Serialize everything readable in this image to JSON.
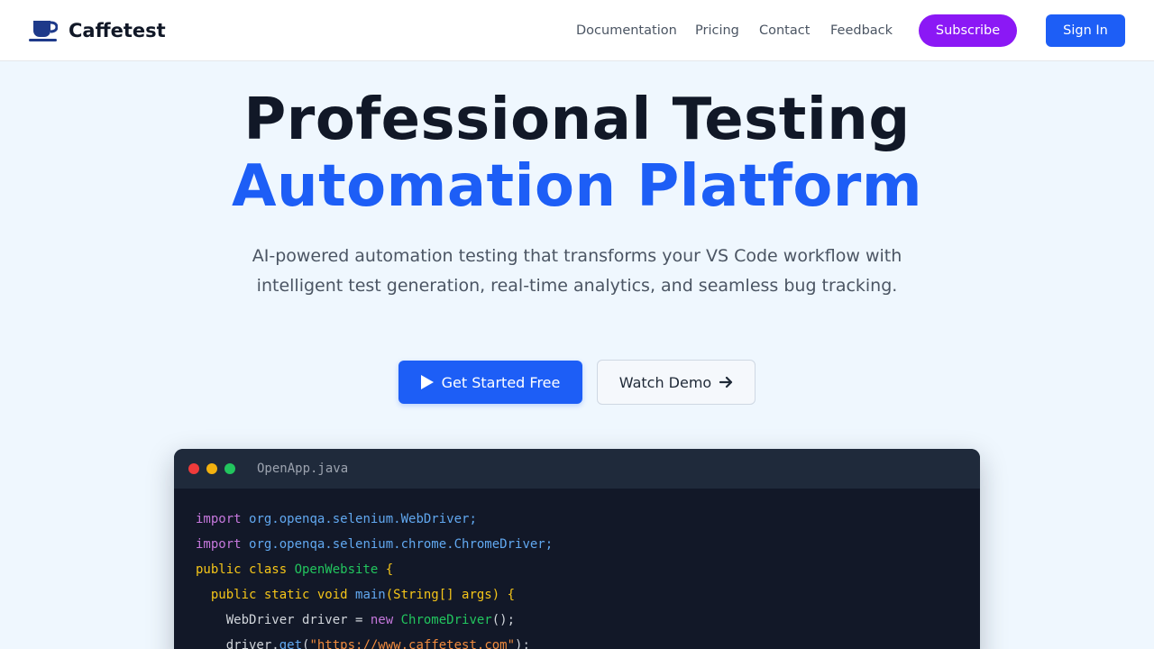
{
  "nav": {
    "brand": "Caffetest",
    "links": [
      "Documentation",
      "Pricing",
      "Contact",
      "Feedback"
    ],
    "subscribe": "Subscribe",
    "sign_in": "Sign In"
  },
  "hero": {
    "title_line1": "Professional Testing",
    "title_line2": "Automation Platform",
    "subtitle": "AI-powered automation testing that transforms your VS Code workflow with intelligent test generation, real-time analytics, and seamless bug tracking.",
    "primary_cta": "Get Started Free",
    "secondary_cta": "Watch Demo"
  },
  "code": {
    "filename": "OpenApp.java",
    "lines": [
      [
        {
          "t": "import ",
          "c": "#c678dd"
        },
        {
          "t": "org.openqa.selenium.WebDriver;",
          "c": "#61a8f0"
        }
      ],
      [
        {
          "t": "import ",
          "c": "#c678dd"
        },
        {
          "t": "org.openqa.selenium.chrome.ChromeDriver;",
          "c": "#61a8f0"
        }
      ],
      [
        {
          "t": "public class ",
          "c": "#f5c518"
        },
        {
          "t": "OpenWebsite",
          "c": "#22c55e"
        },
        {
          "t": " {",
          "c": "#f5c518"
        }
      ],
      [
        {
          "t": "  public static void ",
          "c": "#f5c518"
        },
        {
          "t": "main",
          "c": "#61a8f0"
        },
        {
          "t": "(String[] args) {",
          "c": "#f5c518"
        }
      ],
      [
        {
          "t": "    WebDriver driver = ",
          "c": "#d1d5db"
        },
        {
          "t": "new ",
          "c": "#c678dd"
        },
        {
          "t": "ChromeDriver",
          "c": "#22c55e"
        },
        {
          "t": "();",
          "c": "#d1d5db"
        }
      ],
      [
        {
          "t": "    driver.",
          "c": "#d1d5db"
        },
        {
          "t": "get",
          "c": "#61a8f0"
        },
        {
          "t": "(",
          "c": "#d1d5db"
        },
        {
          "t": "\"https://www.caffetest.com\"",
          "c": "#f08a3c"
        },
        {
          "t": ");",
          "c": "#d1d5db"
        }
      ]
    ]
  },
  "colors": {
    "accent": "#1d5ef6",
    "subscribe": "#8b18f5",
    "page_bg": "#eff7fe",
    "code_bg": "#121828"
  },
  "icons": {
    "brand": "coffee-cup-icon",
    "primary_cta": "play-icon",
    "secondary_cta": "arrow-right-icon"
  }
}
